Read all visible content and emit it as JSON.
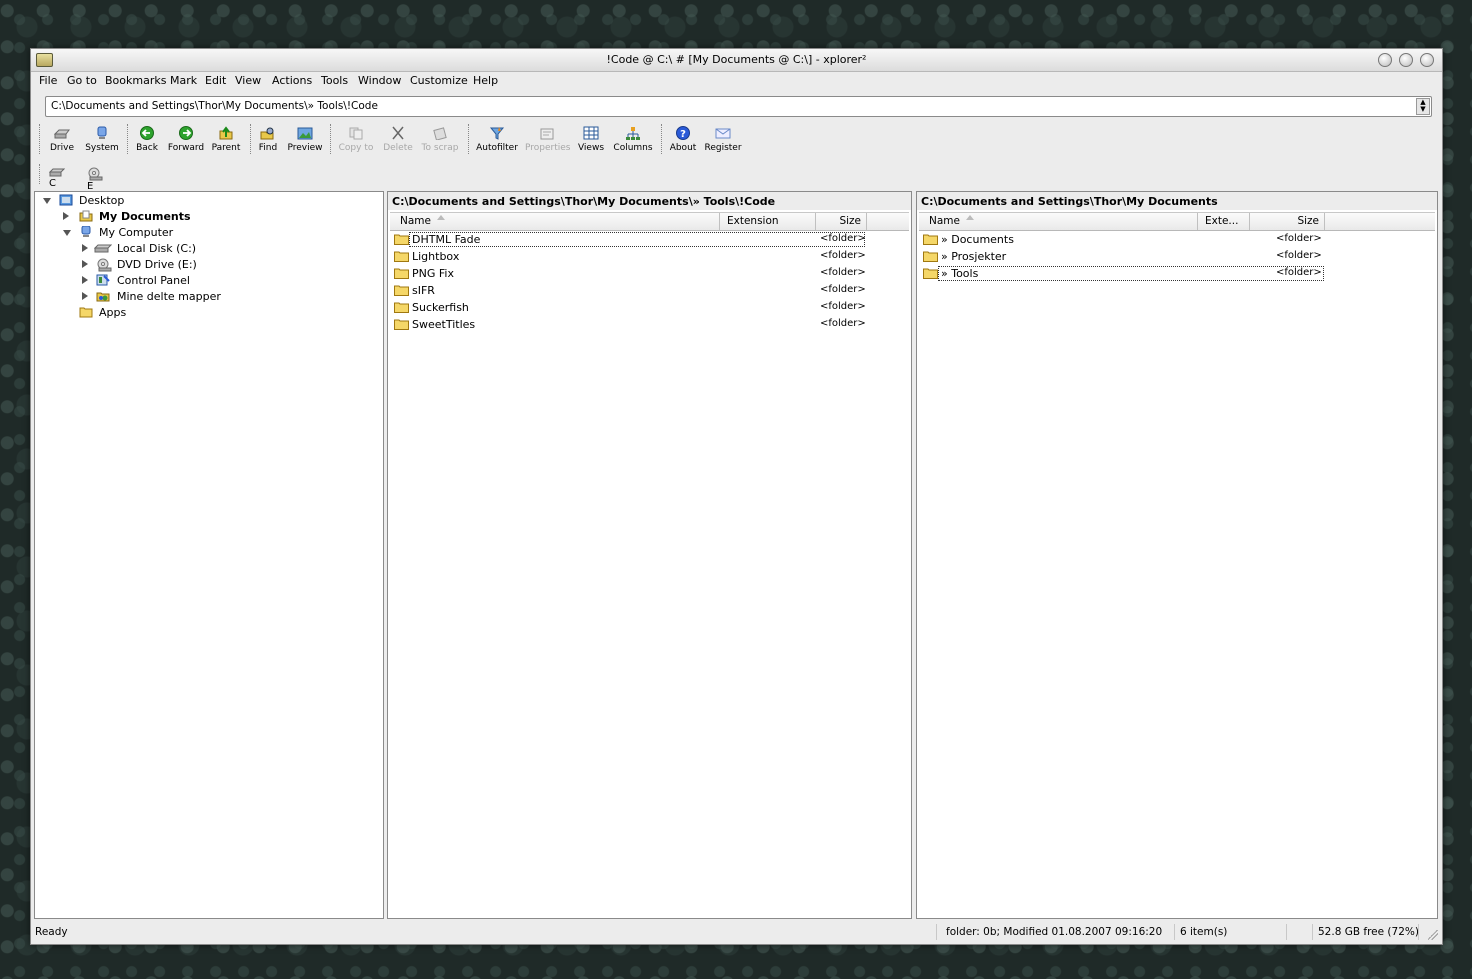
{
  "window": {
    "title": "!Code @ C:\\ # [My Documents @ C:\\] - xplorer²"
  },
  "menu": [
    "File",
    "Go to",
    "Bookmarks",
    "Mark",
    "Edit",
    "View",
    "Actions",
    "Tools",
    "Window",
    "Customize",
    "Help"
  ],
  "address": {
    "value": "C:\\Documents and Settings\\Thor\\My Documents\\» Tools\\!Code"
  },
  "toolbar": [
    {
      "label": "Drive",
      "icon": "drive-icon",
      "enabled": true
    },
    {
      "label": "System",
      "icon": "system-icon",
      "enabled": true
    },
    {
      "label": "Back",
      "icon": "back-icon",
      "enabled": true
    },
    {
      "label": "Forward",
      "icon": "forward-icon",
      "enabled": true
    },
    {
      "label": "Parent",
      "icon": "parent-icon",
      "enabled": true
    },
    {
      "label": "Find",
      "icon": "find-icon",
      "enabled": true
    },
    {
      "label": "Preview",
      "icon": "preview-icon",
      "enabled": true
    },
    {
      "label": "Copy to",
      "icon": "copy-to-icon",
      "enabled": false
    },
    {
      "label": "Delete",
      "icon": "delete-icon",
      "enabled": false
    },
    {
      "label": "To scrap",
      "icon": "scrap-icon",
      "enabled": false
    },
    {
      "label": "Autofilter",
      "icon": "autofilter-icon",
      "enabled": true
    },
    {
      "label": "Properties",
      "icon": "properties-icon",
      "enabled": false
    },
    {
      "label": "Views",
      "icon": "views-icon",
      "enabled": true
    },
    {
      "label": "Columns",
      "icon": "columns-icon",
      "enabled": true
    },
    {
      "label": "About",
      "icon": "about-icon",
      "enabled": true
    },
    {
      "label": "Register",
      "icon": "register-icon",
      "enabled": true
    }
  ],
  "drives": [
    "C",
    "E"
  ],
  "tree": [
    {
      "label": "Desktop",
      "icon": "desktop-icon",
      "expander": "down",
      "bold": false
    },
    {
      "label": "My Documents",
      "icon": "my-documents-icon",
      "expander": "right",
      "bold": true
    },
    {
      "label": "My Computer",
      "icon": "my-computer-icon",
      "expander": "down",
      "bold": false
    },
    {
      "label": "Local Disk (C:)",
      "icon": "local-disk-icon",
      "expander": "right",
      "bold": false
    },
    {
      "label": "DVD Drive (E:)",
      "icon": "dvd-drive-icon",
      "expander": "right",
      "bold": false
    },
    {
      "label": "Control Panel",
      "icon": "control-panel-icon",
      "expander": "right",
      "bold": false
    },
    {
      "label": "Mine delte mapper",
      "icon": "shared-folders-icon",
      "expander": "right",
      "bold": false
    },
    {
      "label": "Apps",
      "icon": "folder-icon",
      "expander": "none",
      "bold": false
    }
  ],
  "left_pane": {
    "path": "C:\\Documents and Settings\\Thor\\My Documents\\» Tools\\!Code",
    "columns": {
      "name": "Name",
      "extension": "Extension",
      "size": "Size"
    },
    "rows": [
      {
        "name": "DHTML Fade",
        "size": "<folder>"
      },
      {
        "name": "Lightbox",
        "size": "<folder>"
      },
      {
        "name": "PNG Fix",
        "size": "<folder>"
      },
      {
        "name": "sIFR",
        "size": "<folder>"
      },
      {
        "name": "Suckerfish",
        "size": "<folder>"
      },
      {
        "name": "SweetTitles",
        "size": "<folder>"
      }
    ]
  },
  "right_pane": {
    "path": "C:\\Documents and Settings\\Thor\\My Documents",
    "columns": {
      "name": "Name",
      "extension": "Exte...",
      "size": "Size"
    },
    "rows": [
      {
        "name": "» Documents",
        "size": "<folder>"
      },
      {
        "name": "» Prosjekter",
        "size": "<folder>"
      },
      {
        "name": "» Tools",
        "size": "<folder>"
      }
    ]
  },
  "status": {
    "ready": "Ready",
    "info": "folder: 0b; Modified 01.08.2007 09:16:20",
    "count": "6 item(s)",
    "free": "52.8 GB free (72%)"
  }
}
